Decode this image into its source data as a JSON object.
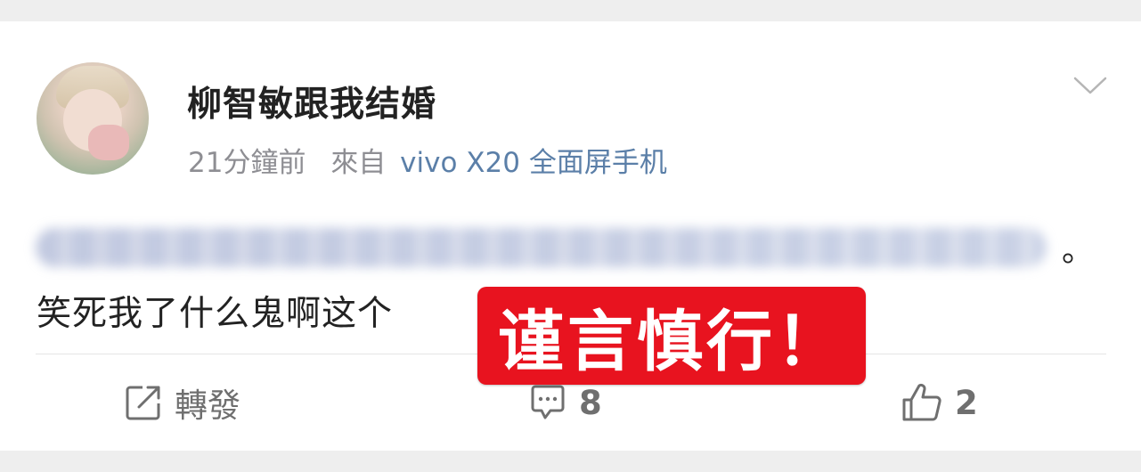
{
  "post": {
    "author": "柳智敏跟我结婚",
    "time": "21分鐘前",
    "source_prefix": "來自",
    "device": "vivo X20 全面屏手机",
    "text_end": "。",
    "content": "笑死我了什么鬼啊这个"
  },
  "actions": {
    "repost_label": "轉發",
    "comment_count": "8",
    "like_count": "2"
  },
  "overlay": {
    "stamp_text": "谨言慎行！"
  },
  "icons": {
    "avatar": "user-avatar",
    "menu": "chevron-down-icon",
    "repost": "repost-icon",
    "comment": "comment-icon",
    "like": "thumbs-up-icon"
  },
  "colors": {
    "device_link": "#5b7fa8",
    "stamp_bg": "#e8131f"
  }
}
